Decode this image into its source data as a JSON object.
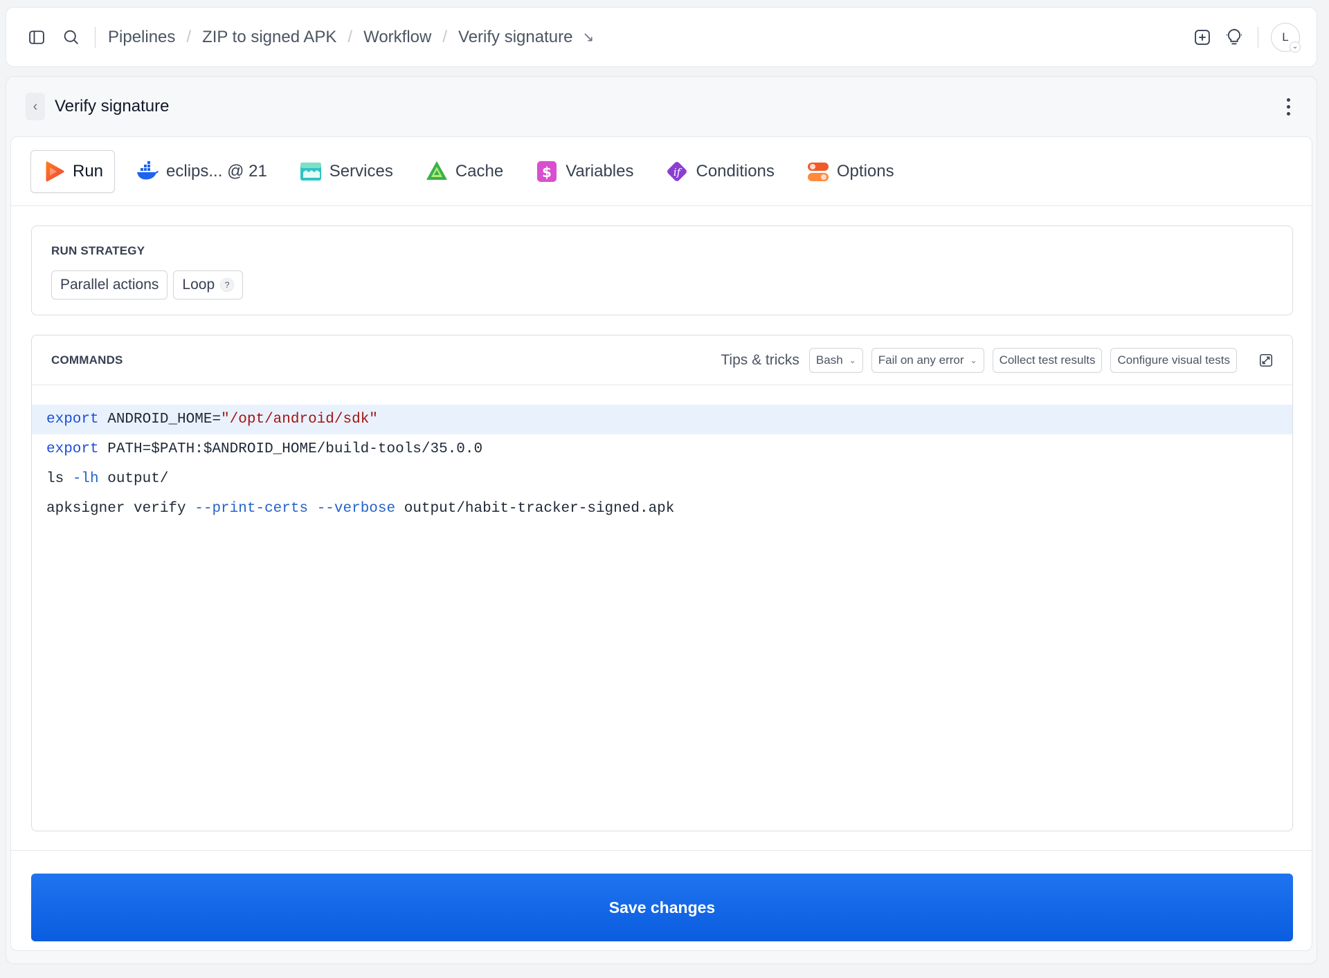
{
  "breadcrumbs": [
    "Pipelines",
    "ZIP to signed APK",
    "Workflow",
    "Verify signature"
  ],
  "avatar_initial": "L",
  "panel": {
    "title": "Verify signature"
  },
  "tabs": [
    {
      "label": "Run",
      "icon": "play-icon",
      "active": true
    },
    {
      "label": "eclips... @ 21",
      "icon": "docker-icon"
    },
    {
      "label": "Services",
      "icon": "services-icon"
    },
    {
      "label": "Cache",
      "icon": "cache-icon"
    },
    {
      "label": "Variables",
      "icon": "dollar-icon"
    },
    {
      "label": "Conditions",
      "icon": "if-icon"
    },
    {
      "label": "Options",
      "icon": "toggles-icon"
    }
  ],
  "run_strategy": {
    "label": "RUN STRATEGY",
    "options": [
      "Parallel actions",
      "Loop"
    ],
    "help": "?"
  },
  "commands": {
    "label": "COMMANDS",
    "tips": "Tips & tricks",
    "shell": "Bash",
    "error_mode": "Fail on any error",
    "collect": "Collect test results",
    "visual": "Configure visual tests",
    "lines": [
      "export ANDROID_HOME=\"/opt/android/sdk\"",
      "export PATH=$PATH:$ANDROID_HOME/build-tools/35.0.0",
      "ls -lh output/",
      "apksigner verify --print-certs --verbose output/habit-tracker-signed.apk"
    ]
  },
  "save_label": "Save changes",
  "colors": {
    "primary": "#0a5ddf",
    "highlight_line": "#e9f2fc"
  }
}
